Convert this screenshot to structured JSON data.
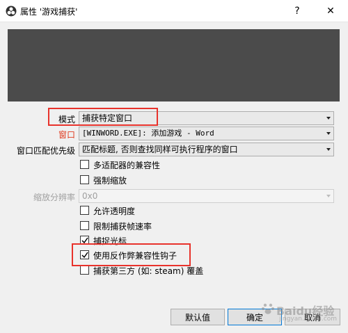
{
  "window": {
    "title": "属性 '游戏捕获'",
    "help_label": "?",
    "close_label": "✕",
    "icon": "obs-icon"
  },
  "form": {
    "mode": {
      "label": "模式",
      "value": "捕获特定窗口"
    },
    "window": {
      "label": "窗口",
      "value": "[WINWORD.EXE]: 添加游戏 - Word"
    },
    "priority": {
      "label": "窗口匹配优先级",
      "value": "匹配标题, 否则查找同样可执行程序的窗口"
    },
    "multi_adapter": {
      "label": "多适配器的兼容性",
      "checked": false
    },
    "force_scale": {
      "label": "强制缩放",
      "checked": false
    },
    "scale_res": {
      "label": "缩放分辨率",
      "value": "0x0"
    },
    "transparency": {
      "label": "允许透明度",
      "checked": false
    },
    "limit_fps": {
      "label": "限制捕获帧速率",
      "checked": false
    },
    "capture_cursor": {
      "label": "捕捉光标",
      "checked": true
    },
    "anticheat_hook": {
      "label": "使用反作弊兼容性钩子",
      "checked": true
    },
    "third_party_overlay": {
      "label": "捕获第三方 (如: steam) 覆盖",
      "checked": false
    }
  },
  "buttons": {
    "defaults": "默认值",
    "ok": "确定",
    "cancel": "取消"
  },
  "watermark": {
    "brand": "Baidu经验",
    "sub": "jingyan.baidu.com"
  },
  "colors": {
    "highlight": "#e8322b",
    "window_label": "#e03a1e",
    "preview_bg": "#4b4b4b"
  }
}
